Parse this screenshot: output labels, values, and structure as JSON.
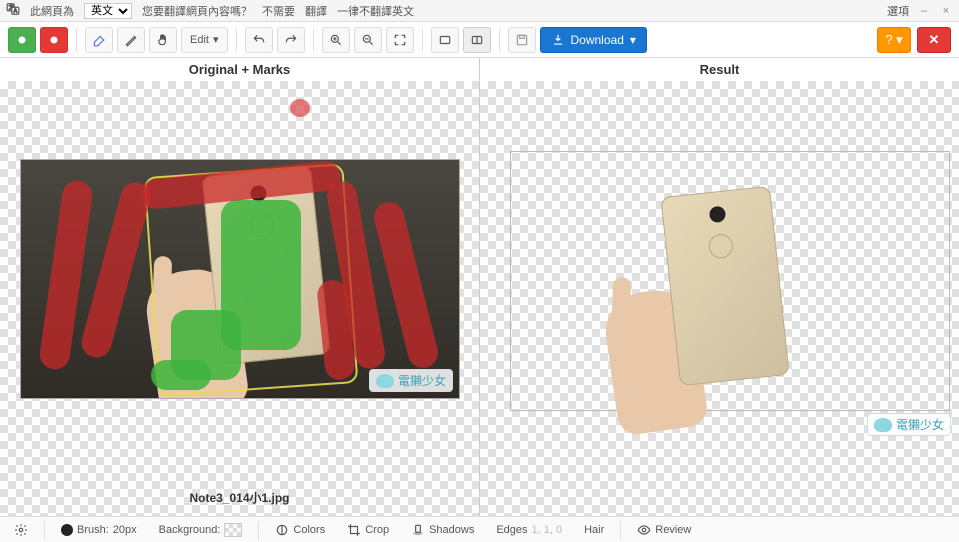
{
  "translate_bar": {
    "detected_prefix": "此網頁為",
    "language": "英文",
    "question": "您要翻譯網頁內容嗎？",
    "no": "不需要",
    "yes": "翻譯",
    "never": "一律不翻譯英文",
    "options": "選項"
  },
  "toolbar": {
    "edit_label": "Edit",
    "download_label": "Download"
  },
  "panels": {
    "left_title": "Original + Marks",
    "right_title": "Result",
    "filename": "Note3_014小1.jpg",
    "watermark": "電獺少女"
  },
  "bottom": {
    "brush_label": "Brush:",
    "brush_value": "20px",
    "background_label": "Background:",
    "colors": "Colors",
    "crop": "Crop",
    "shadows": "Shadows",
    "edges_label": "Edges",
    "edges_value": "1, 1, 0",
    "hair": "Hair",
    "review": "Review"
  },
  "icons": {
    "gear": "gear",
    "eye": "eye"
  }
}
